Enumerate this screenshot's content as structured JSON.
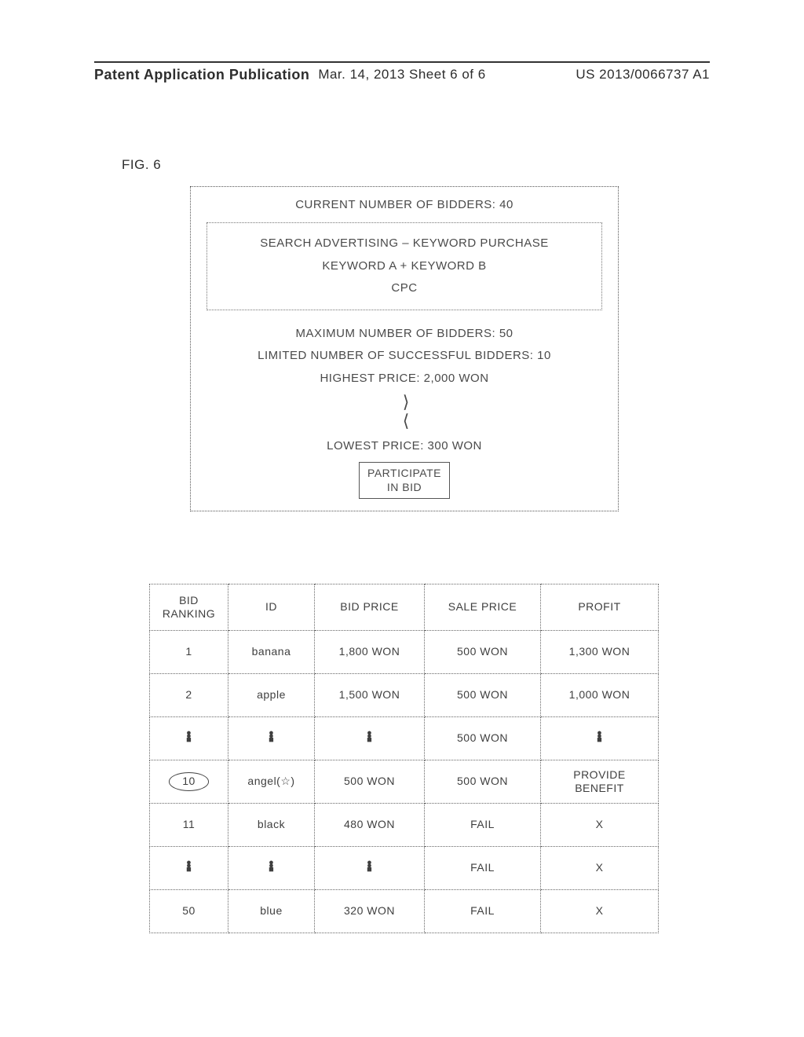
{
  "header": {
    "left": "Patent Application Publication",
    "mid": "Mar. 14, 2013  Sheet 6 of 6",
    "right": "US 2013/0066737 A1"
  },
  "figure_label": "FIG. 6",
  "panel": {
    "current_bidders": "CURRENT NUMBER OF BIDDERS: 40",
    "line1": "SEARCH ADVERTISING – KEYWORD PURCHASE",
    "line2": "KEYWORD A + KEYWORD B",
    "line3": "CPC",
    "max_bidders": "MAXIMUM NUMBER OF BIDDERS: 50",
    "limited_success": "LIMITED NUMBER OF SUCCESSFUL BIDDERS: 10",
    "highest_price": "HIGHEST PRICE: 2,000 WON",
    "countdown_glyph": "⟩\n⟨",
    "lowest_price": "LOWEST PRICE: 300 WON",
    "participate": "PARTICIPATE\nIN BID"
  },
  "table": {
    "headers": {
      "rank": "BID\nRANKING",
      "id": "ID",
      "bid": "BID PRICE",
      "sale": "SALE PRICE",
      "profit": "PROFIT"
    },
    "rows": [
      {
        "rank": "1",
        "circled": false,
        "id": "banana",
        "bid": "1,800 WON",
        "sale": "500 WON",
        "profit": "1,300 WON"
      },
      {
        "rank": "2",
        "circled": false,
        "id": "apple",
        "bid": "1,500 WON",
        "sale": "500 WON",
        "profit": "1,000 WON"
      },
      {
        "rank": "⋮",
        "circled": false,
        "id": "⋮",
        "bid": "⋮",
        "sale": "500 WON",
        "profit": "⋮",
        "vdots": true
      },
      {
        "rank": "10",
        "circled": true,
        "id": "angel(☆)",
        "bid": "500 WON",
        "sale": "500 WON",
        "profit": "PROVIDE\nBENEFIT"
      },
      {
        "rank": "11",
        "circled": false,
        "id": "black",
        "bid": "480 WON",
        "sale": "FAIL",
        "profit": "X"
      },
      {
        "rank": "⋮",
        "circled": false,
        "id": "⋮",
        "bid": "⋮",
        "sale": "FAIL",
        "profit": "X",
        "vdots": true
      },
      {
        "rank": "50",
        "circled": false,
        "id": "blue",
        "bid": "320 WON",
        "sale": "FAIL",
        "profit": "X"
      }
    ]
  }
}
